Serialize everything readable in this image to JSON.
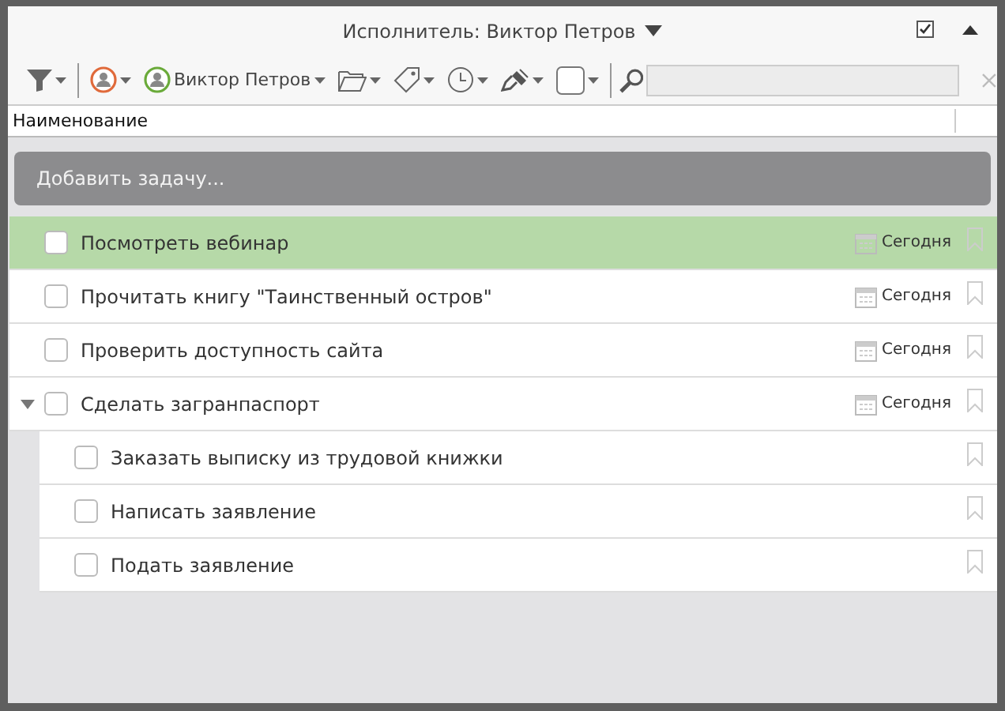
{
  "header": {
    "title": "Исполнитель: Виктор Петров"
  },
  "toolbar": {
    "assignee": "Виктор Петров"
  },
  "columns": [
    "Наименование"
  ],
  "add_task": {
    "placeholder": "Добавить задачу..."
  },
  "tasks": [
    {
      "title": "Посмотреть вебинар",
      "checked": false,
      "selected": true,
      "due": "Сегодня"
    },
    {
      "title": "Прочитать книгу \"Таинственный остров\"",
      "checked": false,
      "selected": false,
      "due": "Сегодня"
    },
    {
      "title": "Проверить доступность сайта",
      "checked": false,
      "selected": false,
      "due": "Сегодня"
    },
    {
      "title": "Сделать загранпаспорт",
      "checked": false,
      "selected": false,
      "due": "Сегодня",
      "expanded": true,
      "children": [
        {
          "title": "Заказать выписку из трудовой книжки",
          "checked": false,
          "selected": false
        },
        {
          "title": "Написать заявление",
          "checked": false,
          "selected": false
        },
        {
          "title": "Подать заявление",
          "checked": false,
          "selected": false
        }
      ]
    }
  ]
}
